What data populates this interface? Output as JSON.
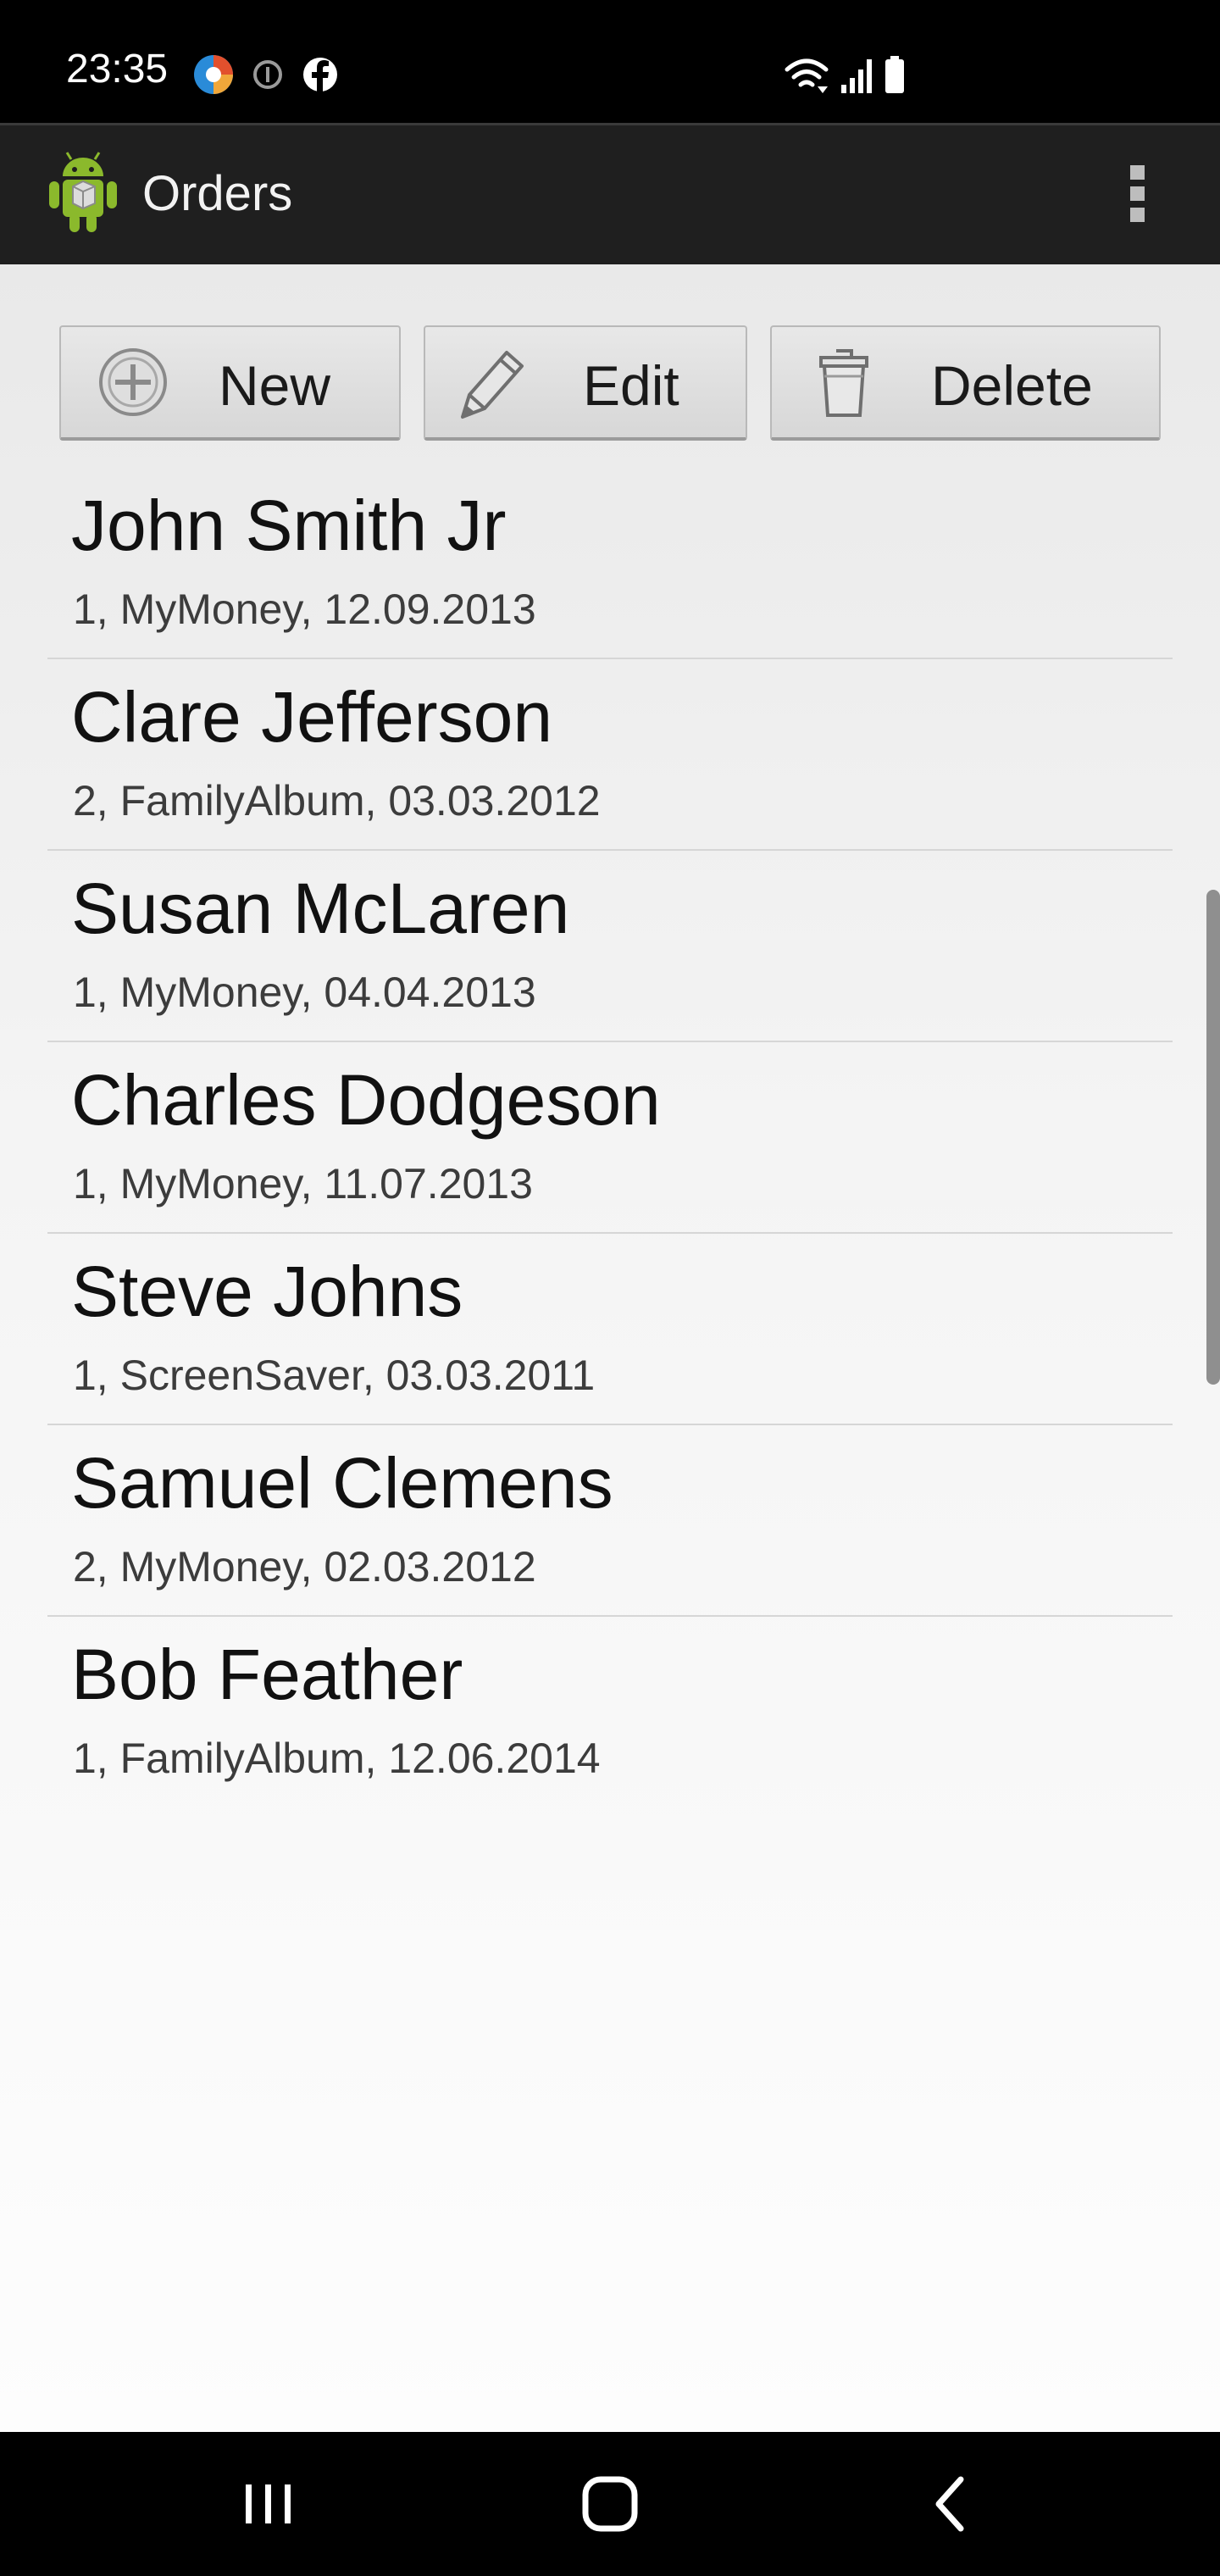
{
  "status_bar": {
    "time": "23:35",
    "app_icons": [
      "browser-icon",
      "info-icon",
      "facebook-icon"
    ],
    "system_icons": [
      "wifi-icon",
      "signal-icon",
      "battery-icon"
    ]
  },
  "app_bar": {
    "title": "Orders",
    "logo": "android-icon",
    "menu": "overflow-menu-icon"
  },
  "toolbar": {
    "new_label": "New",
    "edit_label": "Edit",
    "delete_label": "Delete"
  },
  "orders": [
    {
      "name": "John Smith Jr",
      "details": "1, MyMoney, 12.09.2013"
    },
    {
      "name": "Clare Jefferson",
      "details": "2, FamilyAlbum, 03.03.2012"
    },
    {
      "name": "Susan McLaren",
      "details": "1, MyMoney, 04.04.2013"
    },
    {
      "name": "Charles Dodgeson",
      "details": "1, MyMoney, 11.07.2013"
    },
    {
      "name": "Steve Johns",
      "details": "1, ScreenSaver, 03.03.2011"
    },
    {
      "name": "Samuel Clemens",
      "details": "2, MyMoney, 02.03.2012"
    },
    {
      "name": "Bob Feather",
      "details": "1, FamilyAlbum, 12.06.2014"
    }
  ],
  "nav_bar": {
    "buttons": [
      "recents-icon",
      "home-icon",
      "back-icon"
    ]
  },
  "colors": {
    "status_bar": "#000000",
    "app_bar": "#1f1f1f",
    "android_green": "#8bb92c"
  }
}
